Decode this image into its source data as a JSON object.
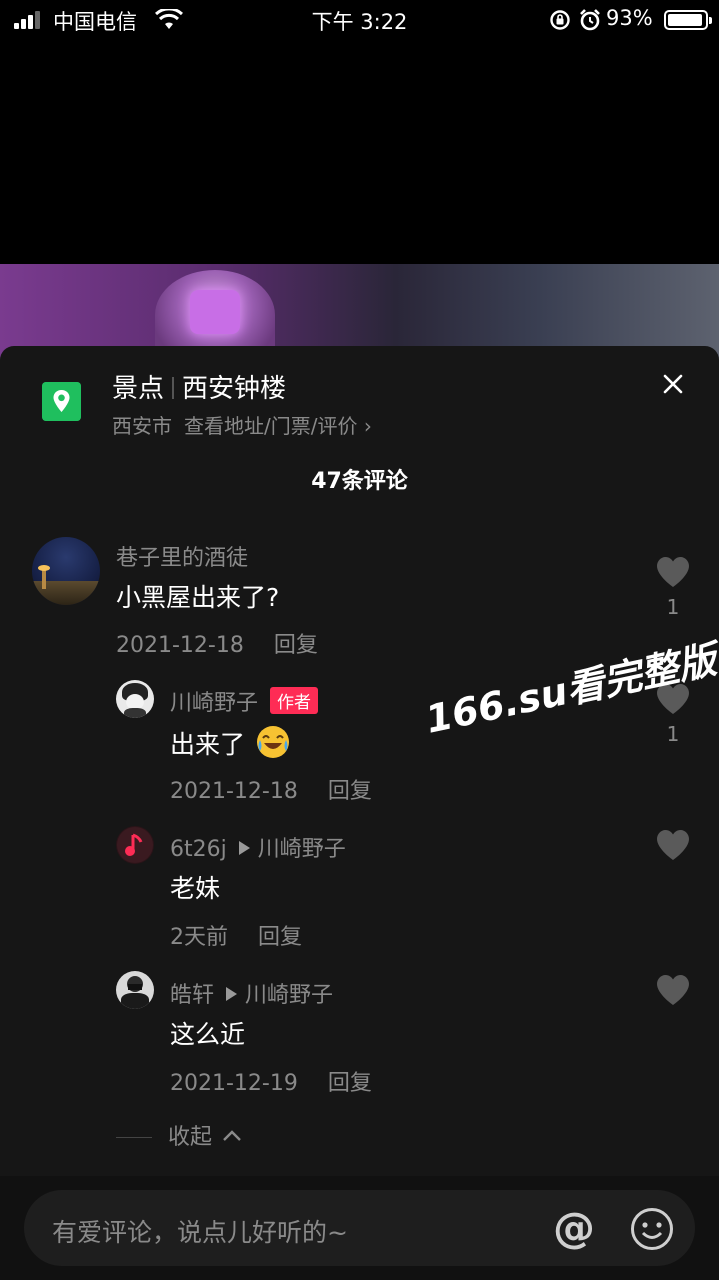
{
  "status_bar": {
    "carrier": "中国电信",
    "time": "下午 3:22",
    "battery": "93%",
    "battery_level": 0.93
  },
  "location": {
    "category": "景点",
    "name": "西安钟楼",
    "city": "西安市",
    "link": "查看地址/门票/评价 ›",
    "icon": "location-pin-icon"
  },
  "comments_count": "47条评论",
  "comments": [
    {
      "user": "巷子里的酒徒",
      "text": "小黑屋出来了?",
      "date": "2021-12-18",
      "reply_label": "回复",
      "likes": "1"
    },
    {
      "user": "川崎野子",
      "tag": "作者",
      "text": "出来了",
      "date": "2021-12-18",
      "reply_label": "回复",
      "likes": "1"
    },
    {
      "user": "6t26j",
      "reply_to": "川崎野子",
      "text": "老妹",
      "date": "2天前",
      "reply_label": "回复"
    },
    {
      "user": "皓轩",
      "reply_to": "川崎野子",
      "text": "这么近",
      "date": "2021-12-19",
      "reply_label": "回复"
    }
  ],
  "collapse_label": "收起",
  "watermark": "166.su看完整版",
  "input": {
    "placeholder": "有爱评论，说点儿好听的~"
  },
  "colors": {
    "author_tag": "#fe2c55",
    "location_icon": "#1fbf5e",
    "sheet_bg": "#161616"
  }
}
